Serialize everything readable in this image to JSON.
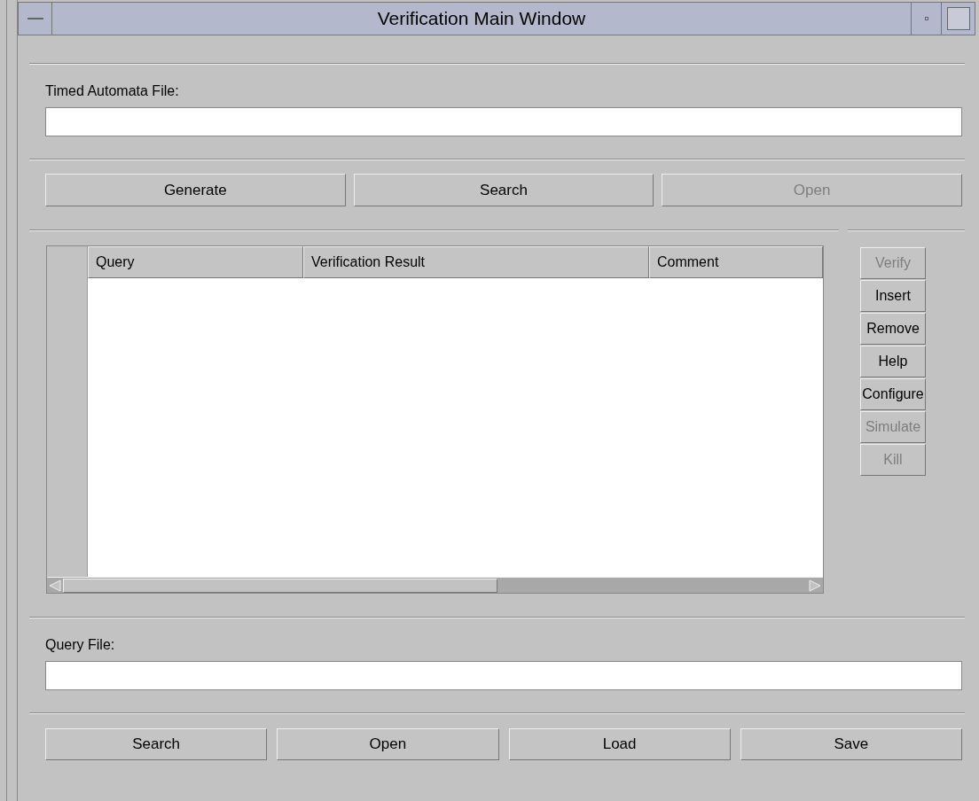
{
  "window": {
    "title": "Verification Main Window"
  },
  "automata_file": {
    "label": "Timed Automata File:"
  },
  "file_buttons": [
    {
      "label": "Generate",
      "disabled": false
    },
    {
      "label": "Search",
      "disabled": false
    },
    {
      "label": "Open",
      "disabled": true
    }
  ],
  "table": {
    "columns": [
      "Query",
      "Verification Result",
      "Comment"
    ]
  },
  "side_buttons": [
    {
      "label": "Verify",
      "disabled": true
    },
    {
      "label": "Insert",
      "disabled": false
    },
    {
      "label": "Remove",
      "disabled": false
    },
    {
      "label": "Help",
      "disabled": false
    },
    {
      "label": "Configure",
      "disabled": false
    },
    {
      "label": "Simulate",
      "disabled": true
    },
    {
      "label": "Kill",
      "disabled": true
    }
  ],
  "query_file": {
    "label": "Query File:"
  },
  "query_buttons": [
    {
      "label": "Search",
      "disabled": false
    },
    {
      "label": "Open",
      "disabled": false
    },
    {
      "label": "Load",
      "disabled": false
    },
    {
      "label": "Save",
      "disabled": false
    }
  ]
}
